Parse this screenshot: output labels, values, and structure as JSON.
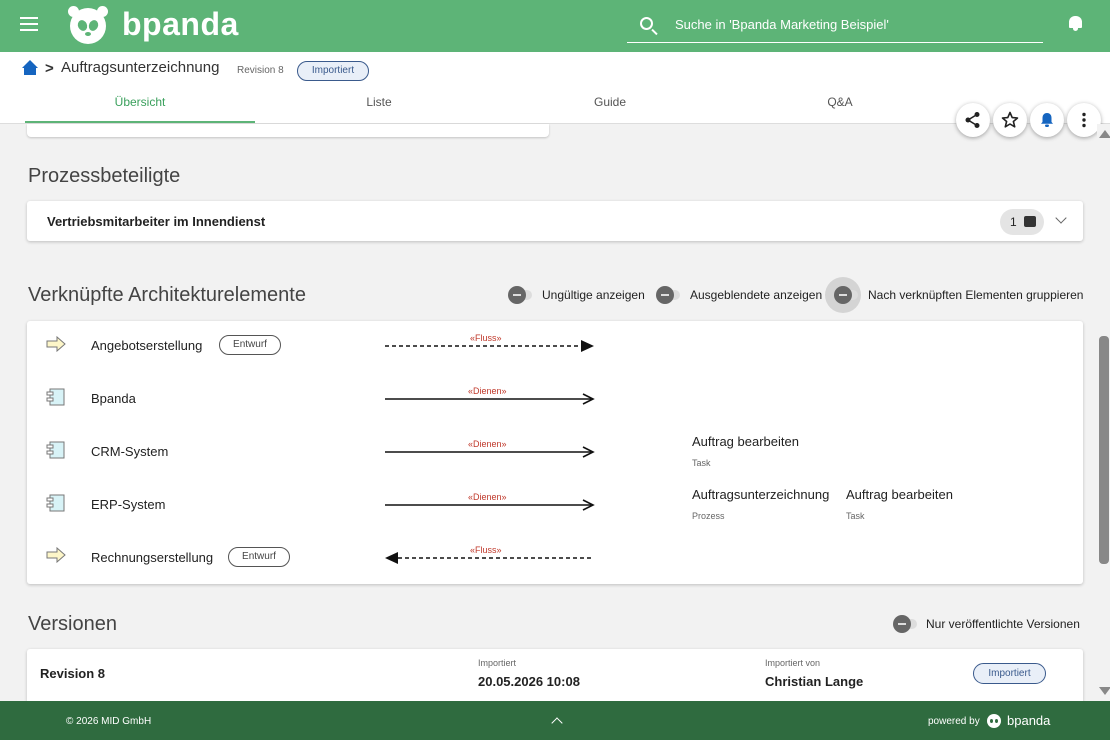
{
  "app": {
    "brand": "bpanda"
  },
  "search": {
    "placeholder": "Suche in 'Bpanda Marketing Beispiel'"
  },
  "breadcrumb": {
    "separator": ">",
    "title": "Auftragsunterzeichnung",
    "revision": "Revision 8",
    "status": "Importiert"
  },
  "tabs": [
    {
      "label": "Übersicht",
      "active": true
    },
    {
      "label": "Liste",
      "active": false
    },
    {
      "label": "Guide",
      "active": false
    },
    {
      "label": "Q&A",
      "active": false
    }
  ],
  "actions": [
    "share-icon",
    "star-icon",
    "bell-icon",
    "more-vert-icon"
  ],
  "participants": {
    "title": "Prozessbeteiligte",
    "role": "Vertriebsmitarbeiter im Innendienst",
    "count": "1"
  },
  "architecture": {
    "title": "Verknüpfte Architekturelemente",
    "toggles": [
      {
        "label": "Ungültige anzeigen",
        "on": false
      },
      {
        "label": "Ausgeblendete anzeigen",
        "on": false
      },
      {
        "label": "Nach verknüpften Elementen gruppieren",
        "on": false
      }
    ],
    "elements": [
      {
        "name": "Angebotserstellung",
        "icon": "flow-arrow-icon",
        "status": "Entwurf",
        "relation": "«Fluss»",
        "line": "dashed",
        "direction": "outgoing",
        "targets": []
      },
      {
        "name": "Bpanda",
        "icon": "component-icon",
        "status": "",
        "relation": "«Dienen»",
        "line": "solid",
        "direction": "outgoing",
        "targets": []
      },
      {
        "name": "CRM-System",
        "icon": "component-icon",
        "status": "",
        "relation": "«Dienen»",
        "line": "solid",
        "direction": "outgoing",
        "targets": [
          {
            "name": "Auftrag bearbeiten",
            "type": "Task"
          }
        ]
      },
      {
        "name": "ERP-System",
        "icon": "component-icon",
        "status": "",
        "relation": "«Dienen»",
        "line": "solid",
        "direction": "outgoing",
        "targets": [
          {
            "name": "Auftragsunterzeichnung",
            "type": "Prozess"
          },
          {
            "name": "Auftrag bearbeiten",
            "type": "Task"
          }
        ]
      },
      {
        "name": "Rechnungserstellung",
        "icon": "flow-arrow-icon",
        "status": "Entwurf",
        "relation": "«Fluss»",
        "line": "dashed",
        "direction": "incoming",
        "targets": []
      }
    ]
  },
  "versions": {
    "title": "Versionen",
    "toggle": "Nur veröffentlichte Versionen",
    "rows": [
      {
        "revision": "Revision 8",
        "state_label": "Importiert",
        "date": "20.05.2026 10:08",
        "by_label": "Importiert von",
        "by": "Christian Lange",
        "badge": "Importiert"
      }
    ]
  },
  "footer": {
    "copyright": "© 2026 MID GmbH",
    "powered": "powered by",
    "brand": "bpanda"
  },
  "colors": {
    "header": "#5db477",
    "footer": "#2f6b3f",
    "accent_blue": "#1565c0",
    "relation_text": "#c0392b"
  }
}
